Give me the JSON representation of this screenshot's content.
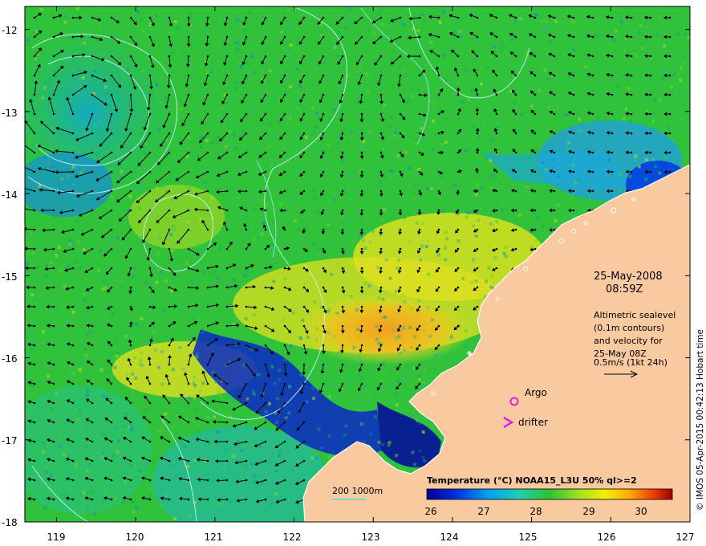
{
  "map": {
    "date": "25-May-2008",
    "time": "08:59Z",
    "altimetry_text": [
      "Altimetric sealevel",
      "(0.1m contours)",
      "and velocity for",
      "25-May 08Z"
    ],
    "velocity_scale": "0.5m/s (1kt 24h)",
    "argo_label": "Argo",
    "drifter_label": "drifter",
    "depth_legend": "200  1000m",
    "colorbar_title": "Temperature (°C) NOAA15_L3U 50% ql>=2",
    "colorbar_ticks": [
      "26",
      "27",
      "28",
      "29",
      "30"
    ],
    "credit": "© IMOS 05-Apr-2015 00:42:13 Hobart time",
    "lat_ticks": [
      "-12",
      "-13",
      "-14",
      "-15",
      "-16",
      "-17",
      "-18"
    ],
    "lon_ticks": [
      "119",
      "120",
      "121",
      "122",
      "123",
      "124",
      "125",
      "126",
      "127"
    ],
    "colors": {
      "ocean_green": "#2fc23a",
      "land": "#f9c9a0",
      "marker": "#e020e0",
      "contour": "#c8f0ff"
    },
    "markers": [
      {
        "type": "argo",
        "lon": 124.8,
        "lat": -16.53
      },
      {
        "type": "drifter",
        "lon": 124.72,
        "lat": -16.78
      }
    ]
  }
}
